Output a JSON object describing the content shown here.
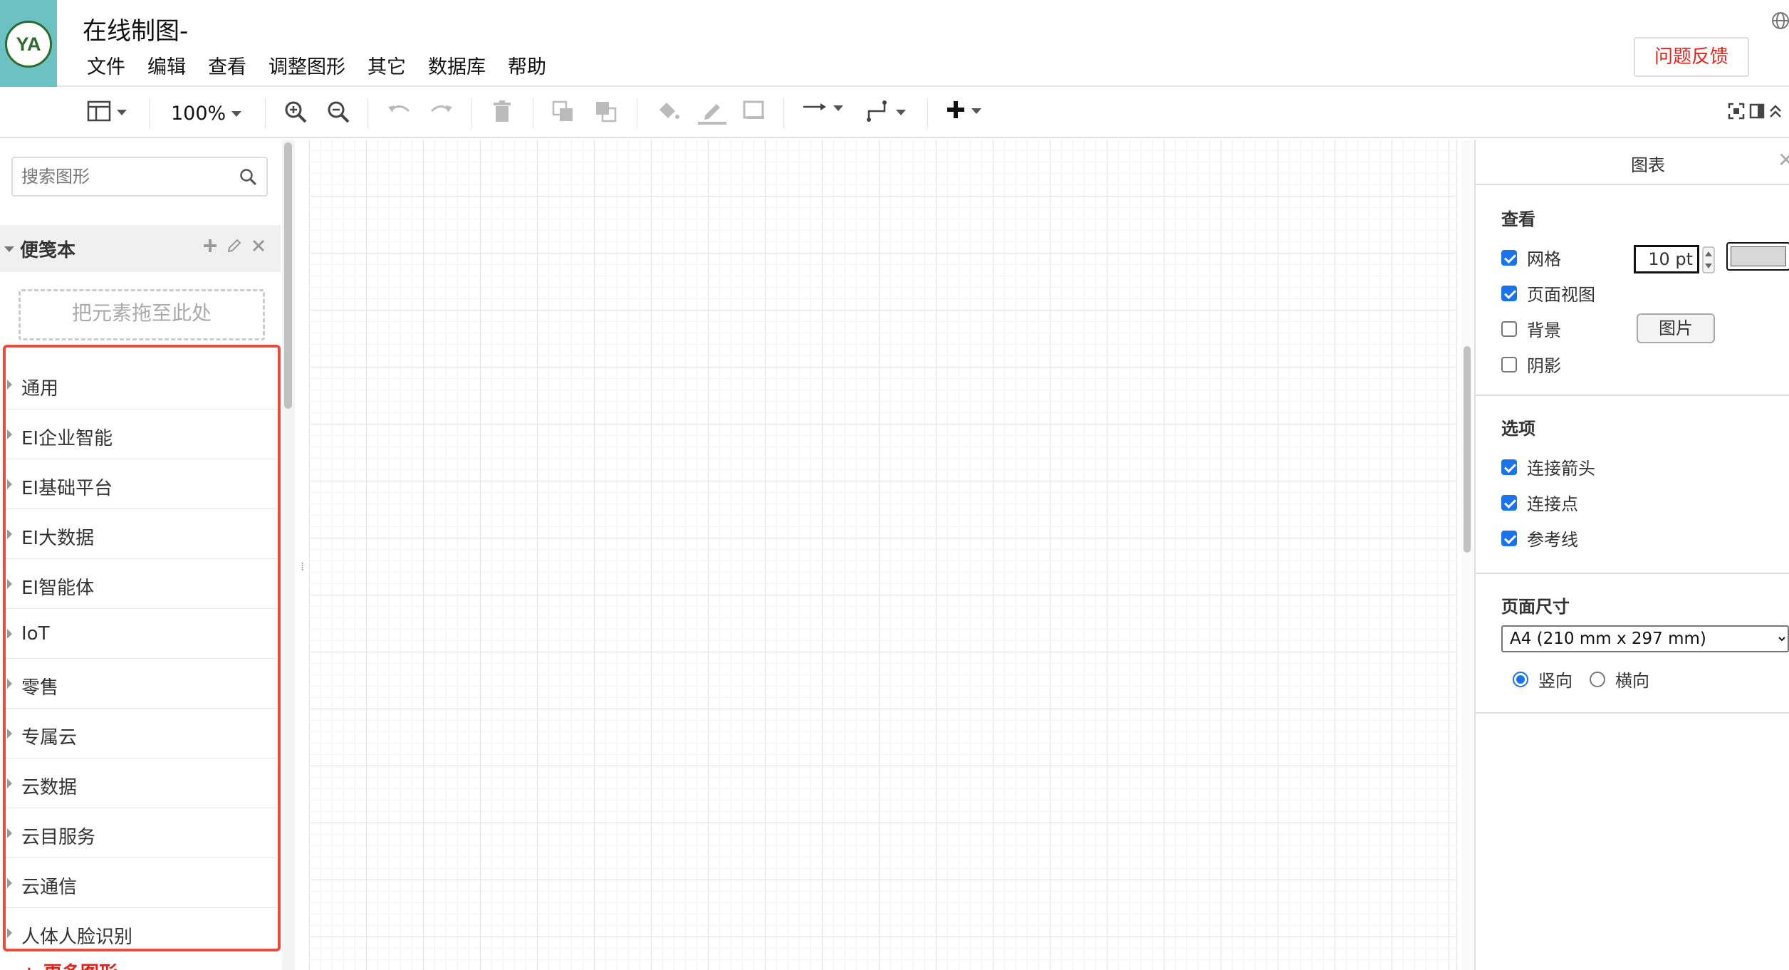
{
  "header": {
    "avatar_text": "YA",
    "title": "在线制图-",
    "menu": [
      "文件",
      "编辑",
      "查看",
      "调整图形",
      "其它",
      "数据库",
      "帮助"
    ],
    "feedback_label": "问题反馈"
  },
  "toolbar": {
    "zoom": "100%"
  },
  "sidebar": {
    "search_placeholder": "搜索图形",
    "scratchpad_title": "便笺本",
    "drop_zone_text": "把元素拖至此处",
    "categories": [
      "通用",
      "EI企业智能",
      "EI基础平台",
      "EI大数据",
      "EI智能体",
      "IoT",
      "零售",
      "专属云",
      "云数据",
      "云目服务",
      "云通信",
      "人体人脸识别"
    ],
    "more_shapes": "+ 更多图形"
  },
  "panel": {
    "tab_label": "图表",
    "view_title": "查看",
    "grid_label": "网格",
    "grid_size": "10 pt",
    "page_view_label": "页面视图",
    "background_label": "背景",
    "image_button": "图片",
    "shadow_label": "阴影",
    "options_title": "选项",
    "connection_arrows_label": "连接箭头",
    "connection_points_label": "连接点",
    "guides_label": "参考线",
    "page_size_title": "页面尺寸",
    "page_size_value": "A4 (210 mm x 297 mm)",
    "portrait_label": "竖向",
    "landscape_label": "横向"
  },
  "colors": {
    "accent": "#6cc1c3",
    "highlight_border": "#e74c3c",
    "feedback_text": "#e0241b",
    "checkbox": "#1a73e8"
  }
}
